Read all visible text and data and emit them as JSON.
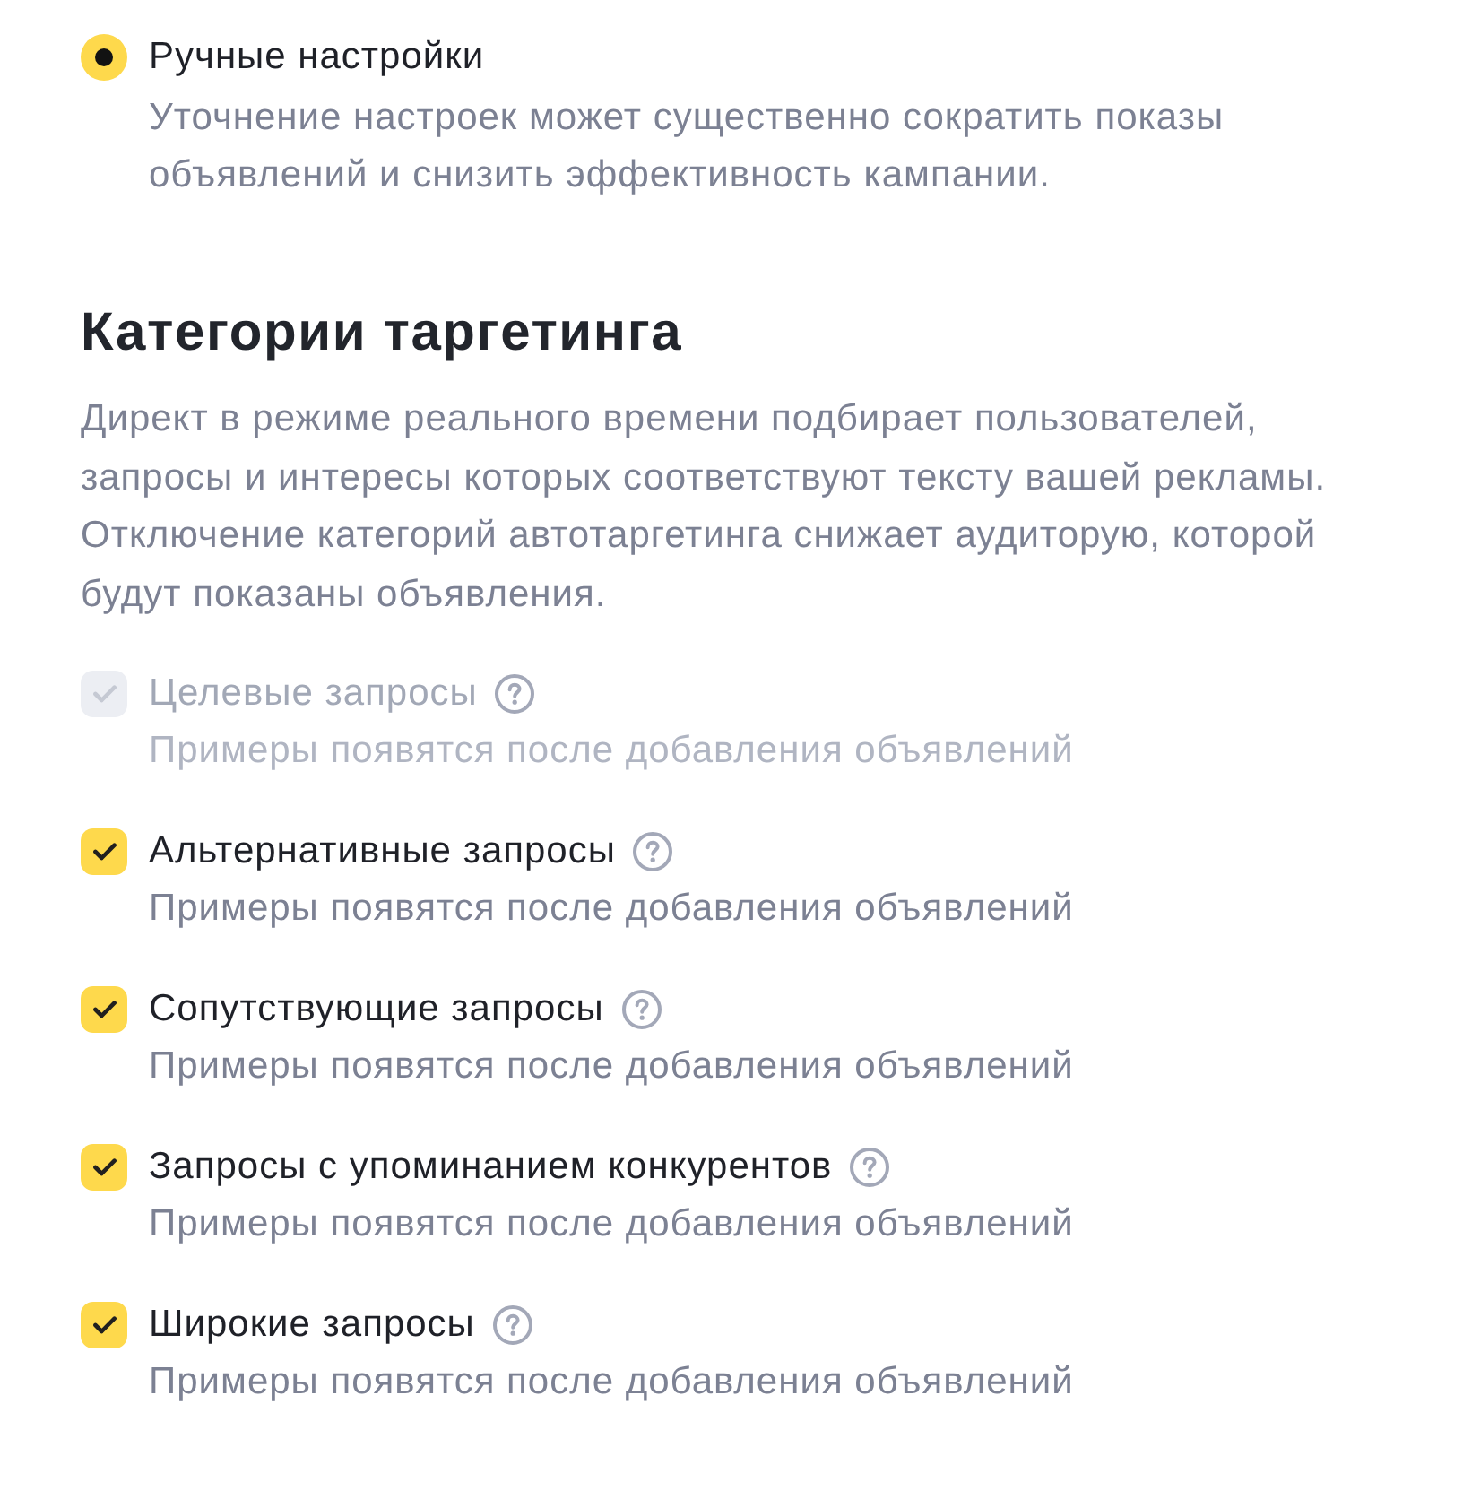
{
  "radio_option": {
    "label": "Ручные настройки",
    "description": "Уточнение настроек может существенно сократить показы объявлений и снизить эффективность кампании.",
    "selected": true
  },
  "section": {
    "title": "Категории таргетинга",
    "description": "Директ в режиме реального времени подбирает пользователей, запросы и интересы которых соответствуют тексту вашей рекламы. Отключение категорий автотаргетинга снижает аудиторую, которой будут показаны объявления."
  },
  "categories": [
    {
      "label": "Целевые запросы",
      "hint": "Примеры появятся после добавления объявлений",
      "checked": true,
      "disabled": true
    },
    {
      "label": "Альтернативные запросы",
      "hint": "Примеры появятся после добавления объявлений",
      "checked": true,
      "disabled": false
    },
    {
      "label": "Сопутствующие запросы",
      "hint": "Примеры появятся после добавления объявлений",
      "checked": true,
      "disabled": false
    },
    {
      "label": "Запросы с упоминанием конкурентов",
      "hint": "Примеры появятся после добавления объявлений",
      "checked": true,
      "disabled": false
    },
    {
      "label": "Широкие запросы",
      "hint": "Примеры появятся после добавления объявлений",
      "checked": true,
      "disabled": false
    }
  ]
}
